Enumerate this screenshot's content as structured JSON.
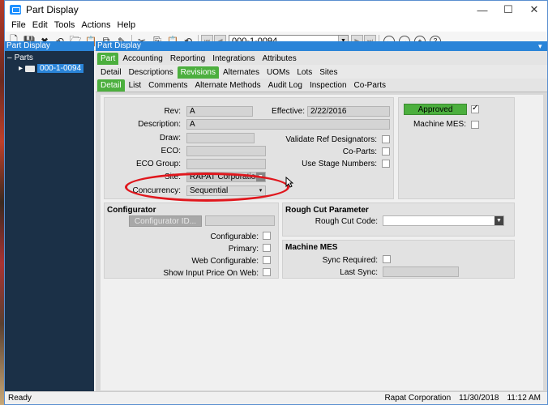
{
  "window": {
    "title": "Part Display"
  },
  "menu": [
    "File",
    "Edit",
    "Tools",
    "Actions",
    "Help"
  ],
  "toolbar": {
    "part_number": "000-1-0094"
  },
  "tree": {
    "header": "Part Display",
    "root": "Parts",
    "child": "000-1-0094"
  },
  "panel": {
    "header": "Part Display"
  },
  "tabs_row1": [
    "Part",
    "Accounting",
    "Reporting",
    "Integrations",
    "Attributes"
  ],
  "tabs_row2": [
    "Detail",
    "Descriptions",
    "Revisions",
    "Alternates",
    "UOMs",
    "Lots",
    "Sites"
  ],
  "tabs_row3": [
    "Detail",
    "List",
    "Comments",
    "Alternate Methods",
    "Audit Log",
    "Inspection",
    "Co-Parts"
  ],
  "form": {
    "rev_label": "Rev:",
    "rev_value": "A",
    "effective_label": "Effective:",
    "effective_value": "2/22/2016",
    "description_label": "Description:",
    "description_value": "A",
    "draw_label": "Draw:",
    "eco_label": "ECO:",
    "eco_group_label": "ECO Group:",
    "site_label": "Site:",
    "site_value": "RAPAT Corporation -PR",
    "concurrency_label": "Concurrency:",
    "concurrency_value": "Sequential",
    "validate_ref_label": "Validate Ref Designators:",
    "coparts_label": "Co-Parts:",
    "use_stage_label": "Use Stage Numbers:",
    "approved_label": "Approved",
    "machine_mes_label": "Machine MES:"
  },
  "configurator": {
    "title": "Configurator",
    "button": "Configurator ID...",
    "configurable_label": "Configurable:",
    "primary_label": "Primary:",
    "web_configurable_label": "Web Configurable:",
    "show_input_price_label": "Show Input Price On Web:"
  },
  "rough_cut": {
    "title": "Rough Cut Parameter",
    "code_label": "Rough Cut Code:"
  },
  "machine_mes": {
    "title": "Machine MES",
    "sync_required_label": "Sync Required:",
    "last_sync_label": "Last Sync:"
  },
  "status": {
    "left": "Ready",
    "company": "Rapat Corporation",
    "date": "11/30/2018",
    "time": "11:12 AM"
  }
}
